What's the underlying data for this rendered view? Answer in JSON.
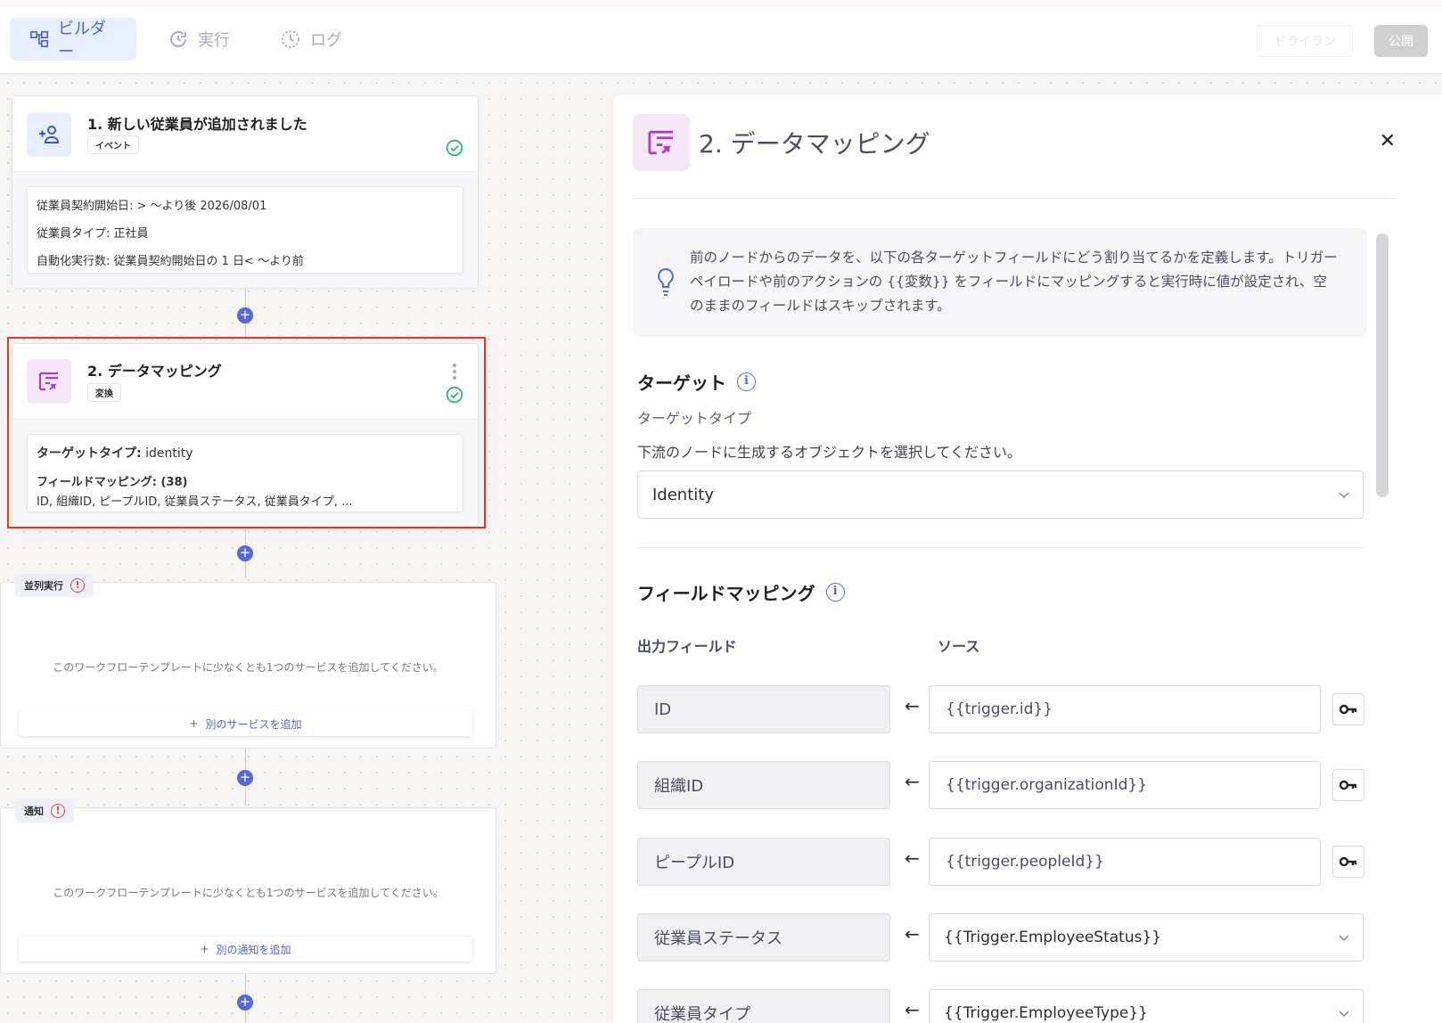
{
  "header": {
    "tabs": [
      {
        "label": "ビルダー",
        "icon": "builder-icon",
        "active": true
      },
      {
        "label": "実行",
        "icon": "refresh-icon",
        "active": false
      },
      {
        "label": "ログ",
        "icon": "log-icon",
        "active": false
      }
    ],
    "dry_run_label": "ドライラン",
    "publish_label": "公開"
  },
  "workflow": {
    "node1": {
      "title": "1. 新しい従業員が追加されました",
      "badge": "イベント",
      "lines": [
        "従業員契約開始日: > 〜より後 2026/08/01",
        "従業員タイプ: 正社員",
        "自動化実行数: 従業員契約開始日の 1 日< 〜より前"
      ]
    },
    "node2": {
      "title": "2. データマッピング",
      "badge": "変換",
      "target_label": "ターゲットタイプ:",
      "target_value": "identity",
      "mapping_label": "フィールドマッピング: (38)",
      "mapping_summary": "ID, 組織ID, ピープルID, 従業員ステータス, 従業員タイプ, ..."
    },
    "parallel": {
      "tag": "並列実行",
      "empty_text": "このワークフローテンプレートに少なくとも1つのサービスを追加してください。",
      "add_label": "別のサービスを追加"
    },
    "notify": {
      "tag": "通知",
      "empty_text": "このワークフローテンプレートに少なくとも1つのサービスを追加してください。",
      "add_label": "別の通知を追加"
    }
  },
  "panel": {
    "title": "2. データマッピング",
    "info": "前のノードからのデータを、以下の各ターゲットフィールドにどう割り当てるかを定義します。トリガーペイロードや前のアクションの {{変数}} をフィールドにマッピングすると実行時に値が設定され、空のままのフィールドはスキップされます。",
    "target_heading": "ターゲット",
    "target_type_label": "ターゲットタイプ",
    "target_desc": "下流のノードに生成するオブジェクトを選択してください。",
    "target_value": "Identity",
    "mapping_heading": "フィールドマッピング",
    "col_output": "出力フィールド",
    "col_source": "ソース",
    "mappings": [
      {
        "field": "ID",
        "source": "{{trigger.id}}"
      },
      {
        "field": "組織ID",
        "source": "{{trigger.organizationId}}"
      },
      {
        "field": "ピープルID",
        "source": "{{trigger.peopleId}}"
      },
      {
        "field": "従業員ステータス",
        "source": "{{Trigger.EmployeeStatus}}"
      },
      {
        "field": "従業員タイプ",
        "source": "{{Trigger.EmployeeType}}"
      }
    ]
  },
  "colors": {
    "accent": "#5769d8",
    "selection": "#e23a24",
    "success": "#2bb673",
    "mapping_icon": "#b33ac7"
  }
}
